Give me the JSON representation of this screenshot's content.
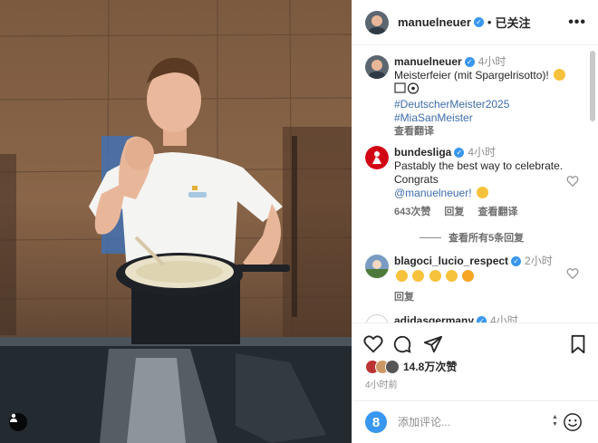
{
  "post": {
    "username": "manuelneuer",
    "follow_status": "已关注",
    "separator": "•",
    "more_label": "•••"
  },
  "caption": {
    "username": "manuelneuer",
    "time": "4小时",
    "text": "Meisterfeier (mit Spargelrisotto)!",
    "hashtags": [
      "#DeutscherMeister2025",
      "#MiaSanMeister"
    ],
    "translate": "查看翻译"
  },
  "comments": [
    {
      "username": "bundesliga",
      "time": "4小时",
      "text": "Pastably the best way to celebrate. Congrats",
      "mention": "@manuelneuer!",
      "likes": "643次赞",
      "reply": "回复",
      "translate": "查看翻译"
    },
    {
      "username": "blagoci_lucio_respect",
      "time": "2小时",
      "reply": "回复"
    },
    {
      "username": "adidasgermany",
      "time": "4小时"
    }
  ],
  "view_replies": "查看所有5条回复",
  "likes_count": "14.8万次赞",
  "post_time": "4小时前",
  "comment_placeholder": "添加评论...",
  "icons": {
    "like": "heart-icon",
    "comment": "comment-icon",
    "share": "share-icon",
    "save": "bookmark-icon",
    "emoji": "emoji-icon",
    "more": "more-icon",
    "user_tag": "user-icon"
  },
  "colors": {
    "link": "#3d6cab",
    "verified": "#3897f0",
    "muted": "#8e8e8e",
    "text": "#262626"
  }
}
